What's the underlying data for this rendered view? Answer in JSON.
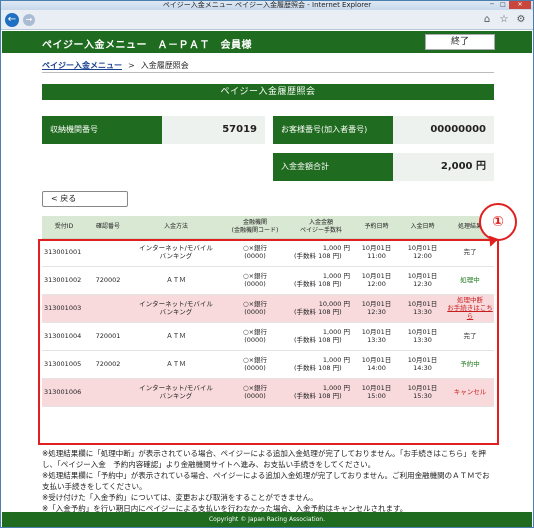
{
  "window": {
    "title": "ペイジー入金メニュー ペイジー入金履歴照会 - Internet Explorer"
  },
  "header": {
    "title": "ペイジー入金メニュー　Ａ－ＰＡＴ　会員様",
    "logout_label": "終了"
  },
  "breadcrumb": {
    "parent": "ペイジー入金メニュー",
    "separator": ">",
    "current": "入金履歴照会"
  },
  "section_title": "ペイジー入金履歴照会",
  "info": {
    "agency_label": "収納機関番号",
    "agency_value": "57019",
    "customer_label": "お客様番号(加入者番号)",
    "customer_value": "00000000",
    "total_label": "入金金額合計",
    "total_value": "2,000 円"
  },
  "back_button": "< 戻る",
  "table": {
    "headers": [
      "受付ID",
      "確認番号",
      "入金方法",
      "金融機関\n(金融機関コード)",
      "入金金額\nペイジー手数料",
      "予約日時",
      "入金日時",
      "処理結果"
    ],
    "rows": [
      {
        "id": "313001001",
        "confirm": "",
        "method": "インターネット/モバイル\nバンキング",
        "bank": "○×銀行\n(0000)",
        "amount": "1,000 円",
        "fee": "(手数料 108 円)",
        "reserve": "10月01日\n11:00",
        "deposit": "10月01日\n12:00",
        "result": "完了",
        "tone": "white",
        "status": "dark"
      },
      {
        "id": "313001002",
        "confirm": "720002",
        "method": "ＡＴＭ",
        "bank": "○×銀行\n(0000)",
        "amount": "1,000 円",
        "fee": "(手数料 108 円)",
        "reserve": "10月01日\n12:00",
        "deposit": "10月01日\n12:30",
        "result": "処理中",
        "tone": "white",
        "status": "green"
      },
      {
        "id": "313001003",
        "confirm": "",
        "method": "インターネット/モバイル\nバンキング",
        "bank": "○×銀行\n(0000)",
        "amount": "10,000 円",
        "fee": "(手数料 108 円)",
        "reserve": "10月01日\n12:30",
        "deposit": "10月01日\n13:30",
        "result": "処理中断",
        "result2": "お手続きはこちら",
        "tone": "pink",
        "status": "red"
      },
      {
        "id": "313001004",
        "confirm": "720001",
        "method": "ＡＴＭ",
        "bank": "○×銀行\n(0000)",
        "amount": "1,000 円",
        "fee": "(手数料 108 円)",
        "reserve": "10月01日\n13:30",
        "deposit": "10月01日\n13:30",
        "result": "完了",
        "tone": "white",
        "status": "dark"
      },
      {
        "id": "313001005",
        "confirm": "720002",
        "method": "ＡＴＭ",
        "bank": "○×銀行\n(0000)",
        "amount": "1,000 円",
        "fee": "(手数料 108 円)",
        "reserve": "10月01日\n14:00",
        "deposit": "10月01日\n14:30",
        "result": "予約中",
        "tone": "white",
        "status": "green"
      },
      {
        "id": "313001006",
        "confirm": "",
        "method": "インターネット/モバイル\nバンキング",
        "bank": "○×銀行\n(0000)",
        "amount": "1,000 円",
        "fee": "(手数料 108 円)",
        "reserve": "10月01日\n15:00",
        "deposit": "10月01日\n15:30",
        "result": "キャンセル",
        "tone": "pink",
        "status": "red"
      }
    ]
  },
  "callout": {
    "label": "①",
    "color": "#e02020"
  },
  "notes": [
    "※処理結果欄に「処理中断」が表示されている場合、ペイジーによる追加入金処理が完了しておりません。「お手続きはこちら」を押し、「ペイジー入金　予約内容確認」より金融機関サイトへ進み、お支払い手続きをしてください。",
    "※処理結果欄に「予約中」が表示されている場合、ペイジーによる追加入金処理が完了しておりません。ご利用金融機関のＡＴＭでお支払い手続きをしてください。",
    "※受け付けた「入金予約」については、変更および取消をすることができません。",
    "※「入金予約」を行い期日内にペイジーによる支払いを行わなかった場合、入金予約はキャンセルされます。"
  ],
  "footer": "Copyright © Japan Racing Association.",
  "colors": {
    "brand_green": "#1f6b1f",
    "row_pink": "#f8dadd",
    "status_green": "#1a7a1a",
    "status_red": "#c81e1e"
  }
}
